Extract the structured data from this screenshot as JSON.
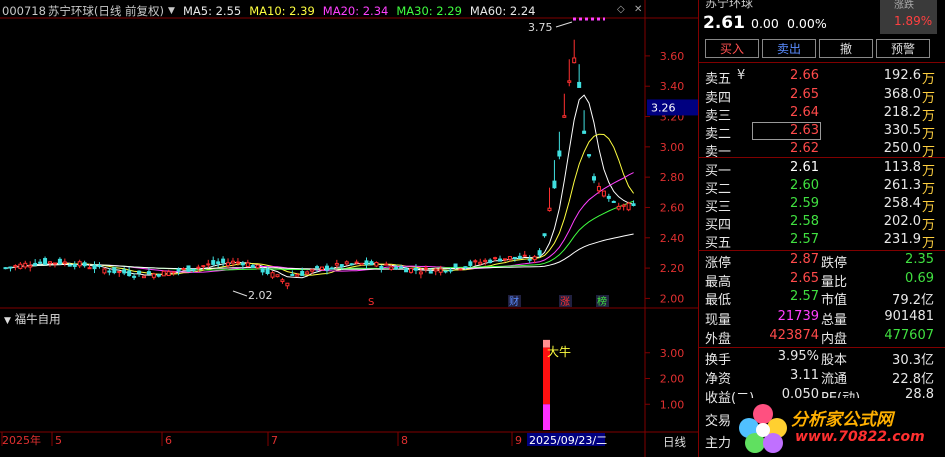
{
  "header": {
    "code": "000718",
    "name": "苏宁环球",
    "period": "(日线 前复权)",
    "ma5": "MA5: 2.55",
    "ma10": "MA10: 2.39",
    "ma20": "MA20: 2.34",
    "ma30": "MA30: 2.29",
    "ma60": "MA60: 2.24"
  },
  "chart_data": {
    "type": "candlestick",
    "ylim": [
      1.95,
      3.85
    ],
    "yticks": [
      "3.60",
      "3.40",
      "3.20",
      "3.00",
      "2.80",
      "2.60",
      "2.40",
      "2.20",
      "2.00"
    ],
    "y_ticks_values": [
      3.6,
      3.4,
      3.2,
      3.0,
      2.8,
      2.6,
      2.4,
      2.2,
      2.0
    ],
    "crosshair_price": "3.26",
    "high_label": "3.75",
    "low_label": "2.02",
    "event_marks": [
      "S",
      "财",
      "涨",
      "榜"
    ],
    "x_labels": [
      "2025年",
      "5",
      "6",
      "7",
      "8",
      "9",
      "2025/09/23/二"
    ],
    "x_label_values": [
      0,
      52,
      162,
      268,
      398,
      512,
      526
    ],
    "series_colors": {
      "ma5": "#ffffff",
      "ma10": "#ffff40",
      "ma20": "#ff40ff",
      "ma30": "#40ff40",
      "ma60": "#ffffff"
    }
  },
  "indicator": {
    "name": "福牛自用",
    "ylim": [
      0,
      4
    ],
    "yticks": [
      "3.00",
      "2.00",
      "1.00"
    ],
    "y_ticks_values": [
      3.0,
      2.0,
      1.0
    ],
    "signal_label": "大牛",
    "bar_value": 3.5
  },
  "period_tab": "日线",
  "quote": {
    "name": "苏宁环球",
    "price": "2.61",
    "change": "0.00",
    "pct": "0.00%",
    "badge_top": "涨跌",
    "badge": "1.89%",
    "buttons": {
      "buy": "买入",
      "sell": "卖出",
      "cancel": "撤",
      "warn": "预警"
    },
    "asks": [
      {
        "label": "卖五",
        "extra": "¥",
        "price": "2.66",
        "vol": "192.6",
        "unit": "万"
      },
      {
        "label": "卖四",
        "extra": "",
        "price": "2.65",
        "vol": "368.0",
        "unit": "万"
      },
      {
        "label": "卖三",
        "extra": "",
        "price": "2.64",
        "vol": "218.2",
        "unit": "万"
      },
      {
        "label": "卖二",
        "extra": "",
        "price": "2.63",
        "vol": "330.5",
        "unit": "万"
      },
      {
        "label": "卖一",
        "extra": "",
        "price": "2.62",
        "vol": "250.0",
        "unit": "万"
      }
    ],
    "bids": [
      {
        "label": "买一",
        "price": "2.61",
        "vol": "113.8",
        "unit": "万"
      },
      {
        "label": "买二",
        "price": "2.60",
        "vol": "261.3",
        "unit": "万"
      },
      {
        "label": "买三",
        "price": "2.59",
        "vol": "258.4",
        "unit": "万"
      },
      {
        "label": "买四",
        "price": "2.58",
        "vol": "202.0",
        "unit": "万"
      },
      {
        "label": "买五",
        "price": "2.57",
        "vol": "231.9",
        "unit": "万"
      }
    ],
    "stats": {
      "zhangting_k": "涨停",
      "zhangting": "2.87",
      "dieting_k": "跌停",
      "dieting": "2.35",
      "zuigao_k": "最高",
      "zuigao": "2.65",
      "liangbi_k": "量比",
      "liangbi": "0.69",
      "zuidi_k": "最低",
      "zuidi": "2.57",
      "shizhi_k": "市值",
      "shizhi": "79.2亿",
      "xianliang_k": "现量",
      "xianliang": "21739",
      "zongliang_k": "总量",
      "zongliang": "901481",
      "waipan_k": "外盘",
      "waipan": "423874",
      "neipan_k": "内盘",
      "neipan": "477607",
      "huanshou_k": "换手",
      "huanshou": "3.95%",
      "guben_k": "股本",
      "guben": "30.3亿",
      "jingzi_k": "净资",
      "jingzi": "3.11",
      "liutong_k": "流通",
      "liutong": "22.8亿",
      "shouyi_k": "收益(二)",
      "shouyi": "0.050",
      "pe_k": "PE(动)",
      "pe": "28.8",
      "jiaoyi_k": "交易",
      "zhuli_k": "主力"
    }
  },
  "watermark": {
    "brand": "分析家公式网",
    "url": "www.70822.com"
  }
}
